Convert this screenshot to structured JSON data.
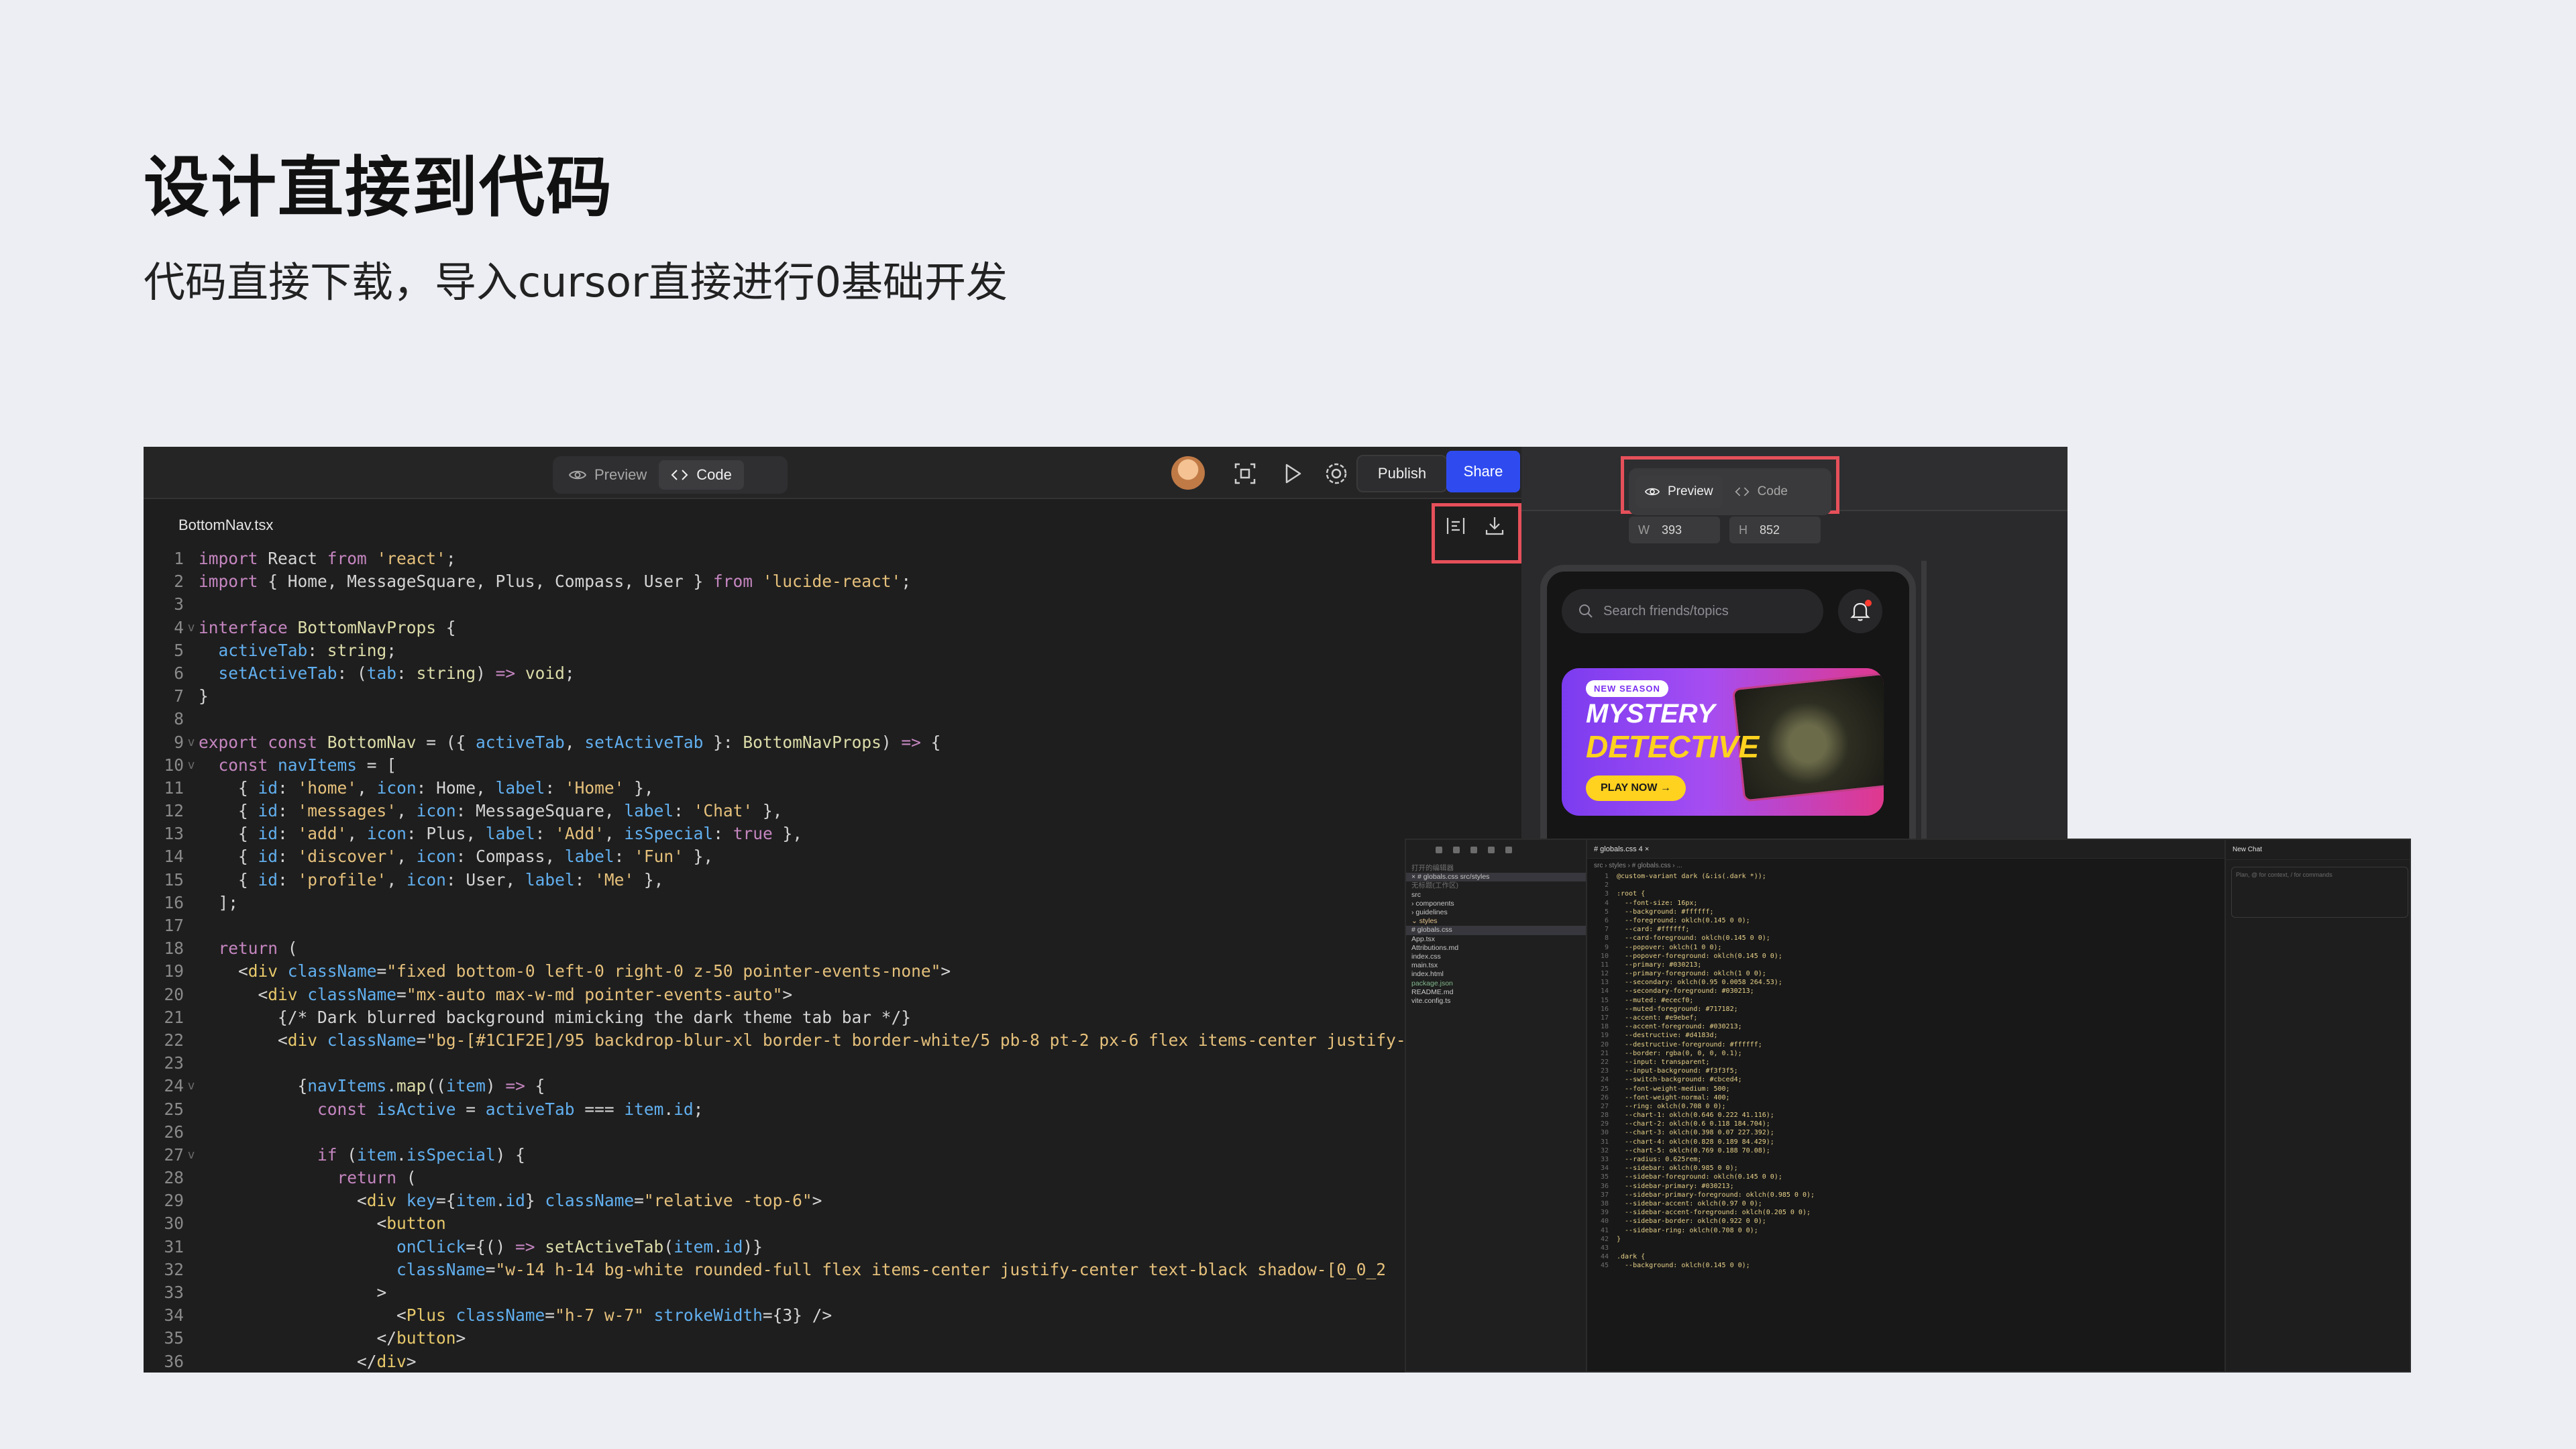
{
  "slide": {
    "title": "设计直接到代码",
    "subtitle": "代码直接下载，导入cursor直接进行0基础开发"
  },
  "editor": {
    "tabs": [
      {
        "label": "Preview",
        "icon": "eye-icon"
      },
      {
        "label": "Code",
        "icon": "code-icon"
      }
    ],
    "toolbar": {
      "publish_label": "Publish",
      "share_label": "Share"
    },
    "file_name": "BottomNav.tsx",
    "accent_colors": {
      "share": "#2f4bf0",
      "highlight": "#e6505a"
    },
    "code_lines": [
      {
        "n": "1",
        "fold": "",
        "t": [
          [
            "kw",
            "import"
          ],
          [
            "tx",
            " React "
          ],
          [
            "kw",
            "from"
          ],
          [
            "str",
            " 'react'"
          ],
          [
            "tx",
            ";"
          ]
        ]
      },
      {
        "n": "2",
        "fold": "",
        "t": [
          [
            "kw",
            "import"
          ],
          [
            "tx",
            " { Home, MessageSquare, Plus, Compass, User } "
          ],
          [
            "kw",
            "from"
          ],
          [
            "str",
            " 'lucide-react'"
          ],
          [
            "tx",
            ";"
          ]
        ]
      },
      {
        "n": "3",
        "fold": "",
        "t": []
      },
      {
        "n": "4",
        "fold": "v",
        "t": [
          [
            "kw",
            "interface"
          ],
          [
            "ty",
            " BottomNavProps"
          ],
          [
            "tx",
            " {"
          ]
        ]
      },
      {
        "n": "5",
        "fold": "",
        "t": [
          [
            "pr",
            "  activeTab"
          ],
          [
            "tx",
            ": "
          ],
          [
            "ty",
            "string"
          ],
          [
            "tx",
            ";"
          ]
        ]
      },
      {
        "n": "6",
        "fold": "",
        "t": [
          [
            "pr",
            "  setActiveTab"
          ],
          [
            "tx",
            ": ("
          ],
          [
            "pr",
            "tab"
          ],
          [
            "tx",
            ": "
          ],
          [
            "ty",
            "string"
          ],
          [
            "tx",
            ") "
          ],
          [
            "kw",
            "=>"
          ],
          [
            "ty",
            " void"
          ],
          [
            "tx",
            ";"
          ]
        ]
      },
      {
        "n": "7",
        "fold": "",
        "t": [
          [
            "tx",
            "}"
          ]
        ]
      },
      {
        "n": "8",
        "fold": "",
        "t": []
      },
      {
        "n": "9",
        "fold": "v",
        "t": [
          [
            "kw",
            "export const"
          ],
          [
            "ty",
            " BottomNav"
          ],
          [
            "tx",
            " = ({ "
          ],
          [
            "pr",
            "activeTab"
          ],
          [
            "tx",
            ", "
          ],
          [
            "pr",
            "setActiveTab"
          ],
          [
            "tx",
            " }: "
          ],
          [
            "ty",
            "BottomNavProps"
          ],
          [
            "tx",
            ") "
          ],
          [
            "kw",
            "=>"
          ],
          [
            "tx",
            " {"
          ]
        ]
      },
      {
        "n": "10",
        "fold": "v",
        "t": [
          [
            "kw",
            "  const"
          ],
          [
            "pr",
            " navItems"
          ],
          [
            "tx",
            " = ["
          ]
        ]
      },
      {
        "n": "11",
        "fold": "",
        "t": [
          [
            "tx",
            "    { "
          ],
          [
            "pr",
            "id"
          ],
          [
            "tx",
            ": "
          ],
          [
            "str",
            "'home'"
          ],
          [
            "tx",
            ", "
          ],
          [
            "pr",
            "icon"
          ],
          [
            "tx",
            ": Home, "
          ],
          [
            "pr",
            "label"
          ],
          [
            "tx",
            ": "
          ],
          [
            "str",
            "'Home'"
          ],
          [
            "tx",
            " },"
          ]
        ]
      },
      {
        "n": "12",
        "fold": "",
        "t": [
          [
            "tx",
            "    { "
          ],
          [
            "pr",
            "id"
          ],
          [
            "tx",
            ": "
          ],
          [
            "str",
            "'messages'"
          ],
          [
            "tx",
            ", "
          ],
          [
            "pr",
            "icon"
          ],
          [
            "tx",
            ": MessageSquare, "
          ],
          [
            "pr",
            "label"
          ],
          [
            "tx",
            ": "
          ],
          [
            "str",
            "'Chat'"
          ],
          [
            "tx",
            " },"
          ]
        ]
      },
      {
        "n": "13",
        "fold": "",
        "t": [
          [
            "tx",
            "    { "
          ],
          [
            "pr",
            "id"
          ],
          [
            "tx",
            ": "
          ],
          [
            "str",
            "'add'"
          ],
          [
            "tx",
            ", "
          ],
          [
            "pr",
            "icon"
          ],
          [
            "tx",
            ": Plus, "
          ],
          [
            "pr",
            "label"
          ],
          [
            "tx",
            ": "
          ],
          [
            "str",
            "'Add'"
          ],
          [
            "tx",
            ", "
          ],
          [
            "pr",
            "isSpecial"
          ],
          [
            "tx",
            ": "
          ],
          [
            "kw",
            "true"
          ],
          [
            "tx",
            " },"
          ]
        ]
      },
      {
        "n": "14",
        "fold": "",
        "t": [
          [
            "tx",
            "    { "
          ],
          [
            "pr",
            "id"
          ],
          [
            "tx",
            ": "
          ],
          [
            "str",
            "'discover'"
          ],
          [
            "tx",
            ", "
          ],
          [
            "pr",
            "icon"
          ],
          [
            "tx",
            ": Compass, "
          ],
          [
            "pr",
            "label"
          ],
          [
            "tx",
            ": "
          ],
          [
            "str",
            "'Fun'"
          ],
          [
            "tx",
            " },"
          ]
        ]
      },
      {
        "n": "15",
        "fold": "",
        "t": [
          [
            "tx",
            "    { "
          ],
          [
            "pr",
            "id"
          ],
          [
            "tx",
            ": "
          ],
          [
            "str",
            "'profile'"
          ],
          [
            "tx",
            ", "
          ],
          [
            "pr",
            "icon"
          ],
          [
            "tx",
            ": User, "
          ],
          [
            "pr",
            "label"
          ],
          [
            "tx",
            ": "
          ],
          [
            "str",
            "'Me'"
          ],
          [
            "tx",
            " },"
          ]
        ]
      },
      {
        "n": "16",
        "fold": "",
        "t": [
          [
            "tx",
            "  ];"
          ]
        ]
      },
      {
        "n": "17",
        "fold": "",
        "t": []
      },
      {
        "n": "18",
        "fold": "",
        "t": [
          [
            "kw",
            "  return"
          ],
          [
            "tx",
            " ("
          ]
        ]
      },
      {
        "n": "19",
        "fold": "",
        "t": [
          [
            "tx",
            "    <"
          ],
          [
            "tg",
            "div"
          ],
          [
            "pr",
            " className"
          ],
          [
            "tx",
            "="
          ],
          [
            "str",
            "\"fixed bottom-0 left-0 right-0 z-50 pointer-events-none\""
          ],
          [
            "tx",
            ">"
          ]
        ]
      },
      {
        "n": "20",
        "fold": "",
        "t": [
          [
            "tx",
            "      <"
          ],
          [
            "tg",
            "div"
          ],
          [
            "pr",
            " className"
          ],
          [
            "tx",
            "="
          ],
          [
            "str",
            "\"mx-auto max-w-md pointer-events-auto\""
          ],
          [
            "tx",
            ">"
          ]
        ]
      },
      {
        "n": "21",
        "fold": "",
        "t": [
          [
            "tx",
            "        {/* Dark blurred background mimicking the dark theme tab bar */}"
          ]
        ]
      },
      {
        "n": "22",
        "fold": "",
        "t": [
          [
            "tx",
            "        <"
          ],
          [
            "tg",
            "div"
          ],
          [
            "pr",
            " className"
          ],
          [
            "tx",
            "="
          ],
          [
            "str",
            "\"bg-[#1C1F2E]/95 backdrop-blur-xl border-t border-white/5 pb-8 pt-2 px-6 flex items-center justify-"
          ]
        ]
      },
      {
        "n": "23",
        "fold": "",
        "t": []
      },
      {
        "n": "24",
        "fold": "v",
        "t": [
          [
            "tx",
            "          {"
          ],
          [
            "pr",
            "navItems"
          ],
          [
            "tx",
            "."
          ],
          [
            "ty",
            "map"
          ],
          [
            "tx",
            "(("
          ],
          [
            "pr",
            "item"
          ],
          [
            "tx",
            ") "
          ],
          [
            "kw",
            "=>"
          ],
          [
            "tx",
            " {"
          ]
        ]
      },
      {
        "n": "25",
        "fold": "",
        "t": [
          [
            "kw",
            "            const"
          ],
          [
            "pr",
            " isActive"
          ],
          [
            "tx",
            " = "
          ],
          [
            "pr",
            "activeTab"
          ],
          [
            "tx",
            " === "
          ],
          [
            "pr",
            "item"
          ],
          [
            "tx",
            "."
          ],
          [
            "pr",
            "id"
          ],
          [
            "tx",
            ";"
          ]
        ]
      },
      {
        "n": "26",
        "fold": "",
        "t": []
      },
      {
        "n": "27",
        "fold": "v",
        "t": [
          [
            "kw",
            "            if"
          ],
          [
            "tx",
            " ("
          ],
          [
            "pr",
            "item"
          ],
          [
            "tx",
            "."
          ],
          [
            "pr",
            "isSpecial"
          ],
          [
            "tx",
            ") {"
          ]
        ]
      },
      {
        "n": "28",
        "fold": "",
        "t": [
          [
            "kw",
            "              return"
          ],
          [
            "tx",
            " ("
          ]
        ]
      },
      {
        "n": "29",
        "fold": "",
        "t": [
          [
            "tx",
            "                <"
          ],
          [
            "tg",
            "div"
          ],
          [
            "pr",
            " key"
          ],
          [
            "tx",
            "={"
          ],
          [
            "pr",
            "item"
          ],
          [
            "tx",
            "."
          ],
          [
            "pr",
            "id"
          ],
          [
            "tx",
            "}"
          ],
          [
            "pr",
            " className"
          ],
          [
            "tx",
            "="
          ],
          [
            "str",
            "\"relative -top-6\""
          ],
          [
            "tx",
            ">"
          ]
        ]
      },
      {
        "n": "30",
        "fold": "",
        "t": [
          [
            "tx",
            "                  <"
          ],
          [
            "tg",
            "button"
          ]
        ]
      },
      {
        "n": "31",
        "fold": "",
        "t": [
          [
            "pr",
            "                    onClick"
          ],
          [
            "tx",
            "={() "
          ],
          [
            "kw",
            "=>"
          ],
          [
            "ty",
            " setActiveTab"
          ],
          [
            "tx",
            "("
          ],
          [
            "pr",
            "item"
          ],
          [
            "tx",
            "."
          ],
          [
            "pr",
            "id"
          ],
          [
            "tx",
            ")}"
          ]
        ]
      },
      {
        "n": "32",
        "fold": "",
        "t": [
          [
            "pr",
            "                    className"
          ],
          [
            "tx",
            "="
          ],
          [
            "str",
            "\"w-14 h-14 bg-white rounded-full flex items-center justify-center text-black shadow-[0_0_2"
          ]
        ]
      },
      {
        "n": "33",
        "fold": "",
        "t": [
          [
            "tx",
            "                  >"
          ]
        ]
      },
      {
        "n": "34",
        "fold": "",
        "t": [
          [
            "tx",
            "                    <"
          ],
          [
            "tg",
            "Plus"
          ],
          [
            "pr",
            " className"
          ],
          [
            "tx",
            "="
          ],
          [
            "str",
            "\"h-7 w-7\""
          ],
          [
            "pr",
            " strokeWidth"
          ],
          [
            "tx",
            "={3} />"
          ]
        ]
      },
      {
        "n": "35",
        "fold": "",
        "t": [
          [
            "tx",
            "                  </"
          ],
          [
            "tg",
            "button"
          ],
          [
            "tx",
            ">"
          ]
        ]
      },
      {
        "n": "36",
        "fold": "",
        "t": [
          [
            "tx",
            "                </"
          ],
          [
            "tg",
            "div"
          ],
          [
            "tx",
            ">"
          ]
        ]
      }
    ]
  },
  "preview": {
    "tabs": [
      {
        "label": "Preview",
        "icon": "eye-icon"
      },
      {
        "label": "Code",
        "icon": "code-icon"
      }
    ],
    "width_label": "W",
    "width_value": "393",
    "height_label": "H",
    "height_value": "852",
    "search_placeholder": "Search friends/topics",
    "banner": {
      "badge": "NEW SEASON",
      "line1": "MYSTERY",
      "line2": "DETECTIVE",
      "cta": "PLAY NOW →"
    }
  },
  "vscode": {
    "tree": [
      {
        "label": "打开的编辑器",
        "cls": "dim2"
      },
      {
        "label": "× # globals.css src/styles",
        "cls": "sel"
      },
      {
        "label": "无标题(工作区)",
        "cls": "dim2"
      },
      {
        "label": "src",
        "cls": ""
      },
      {
        "label": "  › components",
        "cls": ""
      },
      {
        "label": "  › guidelines",
        "cls": ""
      },
      {
        "label": "  ⌄ styles",
        "cls": "yel"
      },
      {
        "label": "    # globals.css",
        "cls": "sel"
      },
      {
        "label": "  App.tsx",
        "cls": ""
      },
      {
        "label": "  Attributions.md",
        "cls": ""
      },
      {
        "label": "  index.css",
        "cls": ""
      },
      {
        "label": "  main.tsx",
        "cls": ""
      },
      {
        "label": "index.html",
        "cls": ""
      },
      {
        "label": "package.json",
        "cls": "green"
      },
      {
        "label": "README.md",
        "cls": ""
      },
      {
        "label": "vite.config.ts",
        "cls": ""
      }
    ],
    "tab_label": "# globals.css 4 ×",
    "breadcrumb": "src › styles › # globals.css › ...",
    "chat_title": "New Chat",
    "chat_placeholder": "Plan, @ for context, / for commands",
    "code": [
      "@custom-variant dark (&:is(.dark *));",
      "",
      ":root {",
      "  --font-size: 16px;",
      "  --background: #ffffff;",
      "  --foreground: oklch(0.145 0 0);",
      "  --card: #ffffff;",
      "  --card-foreground: oklch(0.145 0 0);",
      "  --popover: oklch(1 0 0);",
      "  --popover-foreground: oklch(0.145 0 0);",
      "  --primary: #030213;",
      "  --primary-foreground: oklch(1 0 0);",
      "  --secondary: oklch(0.95 0.0058 264.53);",
      "  --secondary-foreground: #030213;",
      "  --muted: #ececf0;",
      "  --muted-foreground: #717182;",
      "  --accent: #e9ebef;",
      "  --accent-foreground: #030213;",
      "  --destructive: #d4183d;",
      "  --destructive-foreground: #ffffff;",
      "  --border: rgba(0, 0, 0, 0.1);",
      "  --input: transparent;",
      "  --input-background: #f3f3f5;",
      "  --switch-background: #cbced4;",
      "  --font-weight-medium: 500;",
      "  --font-weight-normal: 400;",
      "  --ring: oklch(0.708 0 0);",
      "  --chart-1: oklch(0.646 0.222 41.116);",
      "  --chart-2: oklch(0.6 0.118 184.704);",
      "  --chart-3: oklch(0.398 0.07 227.392);",
      "  --chart-4: oklch(0.828 0.189 84.429);",
      "  --chart-5: oklch(0.769 0.188 70.08);",
      "  --radius: 0.625rem;",
      "  --sidebar: oklch(0.985 0 0);",
      "  --sidebar-foreground: oklch(0.145 0 0);",
      "  --sidebar-primary: #030213;",
      "  --sidebar-primary-foreground: oklch(0.985 0 0);",
      "  --sidebar-accent: oklch(0.97 0 0);",
      "  --sidebar-accent-foreground: oklch(0.205 0 0);",
      "  --sidebar-border: oklch(0.922 0 0);",
      "  --sidebar-ring: oklch(0.708 0 0);",
      "}",
      "",
      ".dark {",
      "  --background: oklch(0.145 0 0);"
    ]
  }
}
